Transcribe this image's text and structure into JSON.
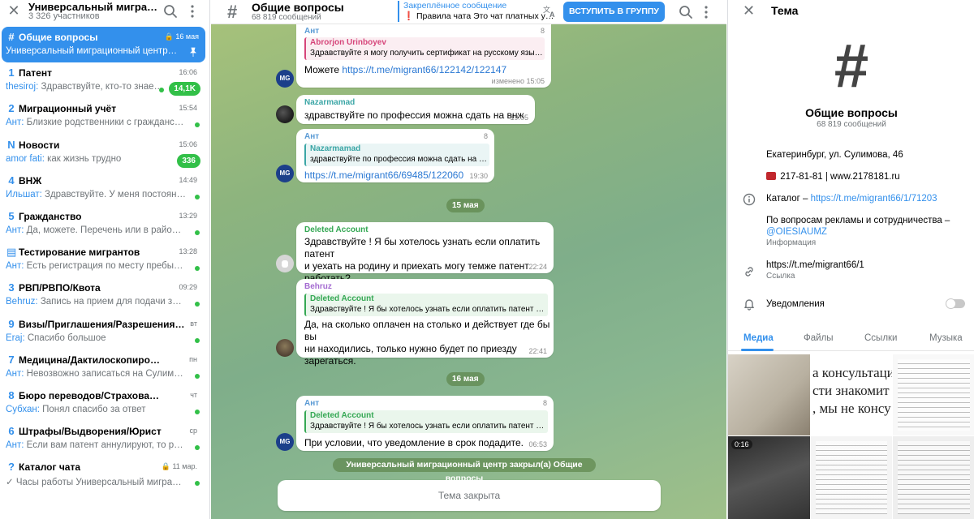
{
  "sidebar": {
    "title": "Универсальный миграционный центр",
    "subtitle": "3 326 участников",
    "topics": [
      {
        "icon": "#",
        "name": "Общие вопросы",
        "time": "16 мая",
        "last": "Универсальный миграционный центр зак…",
        "who": "",
        "active": true
      },
      {
        "icon": "1",
        "name": "Патент",
        "time": "16:06",
        "who": "thesiroj:",
        "last": " Здравствуйте, кто-то знае…",
        "badge": "14,1K"
      },
      {
        "icon": "2",
        "name": "Миграционный учёт",
        "time": "15:54",
        "who": "Ант:",
        "last": " Близкие родственники с гражданство…"
      },
      {
        "icon": "N",
        "name": "Новости",
        "time": "15:06",
        "who": "amor fati:",
        "last": " как жизнь трудно",
        "badge": "336"
      },
      {
        "icon": "4",
        "name": "ВНЖ",
        "time": "14:49",
        "who": "Ильшат:",
        "last": " Здравствуйте. У меня постоянный…"
      },
      {
        "icon": "5",
        "name": "Гражданство",
        "time": "13:29",
        "who": "Ант:",
        "last": " Да, можете. Перечень или в районном…"
      },
      {
        "icon": "▤",
        "name": "Тестирование мигрантов",
        "time": "13:28",
        "who": "Ант:",
        "last": " Есть регистрация по месту пребывани…"
      },
      {
        "icon": "3",
        "name": "РВП/РВПО/Квота",
        "time": "09:29",
        "who": "Behruz:",
        "last": " Запись на прием для подачи заявк…"
      },
      {
        "icon": "9",
        "name": "Визы/Приглашения/Разрешения на ра…",
        "time": "вт",
        "who": "Eraj:",
        "last": " Спасибо большое"
      },
      {
        "icon": "7",
        "name": "Медицина/Дактилоскопирование",
        "time": "пн",
        "who": "Ант:",
        "last": " Невозвожно записаться на Сулимова …"
      },
      {
        "icon": "8",
        "name": "Бюро переводов/Страхование",
        "time": "чт",
        "who": "Субхан:",
        "last": " Понял спасибо за ответ"
      },
      {
        "icon": "6",
        "name": "Штрафы/Выдворения/Юрист",
        "time": "ср",
        "who": "Ант:",
        "last": " Если вам патент аннулируют, то работ…"
      },
      {
        "icon": "?",
        "name": "Каталог чата",
        "time": "11 мар.",
        "who": "✓",
        "last": " Часы работы Универсальный миграцио…"
      }
    ]
  },
  "chat": {
    "title": "Общие вопросы",
    "subtitle": "68 819 сообщений",
    "pinned_label": "Закреплённое сообщение",
    "pinned_text": "❗ Правила чата Это чат платных у…",
    "join_label": "ВСТУПИТЬ В ГРУППУ",
    "messages": {
      "m1": {
        "sender": "Ант",
        "num": "8",
        "reply_name": "Abrorjon Urinboyev",
        "reply_text": "Здравствуйте я могу получить сертификат на русскому языку в…",
        "text": "Можете ",
        "link": "https://t.me/migrant66/122142/122147",
        "time": "изменено 15:05"
      },
      "m2": {
        "sender": "Nazarmamad",
        "text": "здравствуйте по профессия можна сдать на внж",
        "time": "19:05"
      },
      "m3": {
        "sender": "Ант",
        "num": "8",
        "reply_name": "Nazarmamad",
        "reply_text": "здравствуйте по профессия можна сдать на внж",
        "link": "https://t.me/migrant66/69485/122060",
        "time": "19:30"
      },
      "date1": "15 мая",
      "m4": {
        "sender": "Deleted Account",
        "line1": "Здравствуйте  ! Я бы хотелось узнать если оплатить патент",
        "line2": "и  уехать на родину и приехать могу темже патент",
        "line3": "работать?",
        "time": "22:24"
      },
      "m5": {
        "sender": "Behruz",
        "reply_name": "Deleted Account",
        "reply_text": "Здравствуйте ! Я бы хотелось узнать если оплатить патент и уе…",
        "line1": "Да, на сколько оплачен на столько и действует где бы вы",
        "line2": "ни находились, только нужно будет по приезду зарегаться.",
        "time": "22:41"
      },
      "date2": "16 мая",
      "m6": {
        "sender": "Ант",
        "num": "8",
        "reply_name": "Deleted Account",
        "reply_text": "Здравствуйте ! Я бы хотелось узнать если оплатить патент и уе…",
        "text": "При условии, что уведомление в срок подадите.",
        "time": "06:53"
      }
    },
    "avatar_mg": "MG",
    "service_msg": "Универсальный миграционный центр закрыл(а) Общие вопросы",
    "closed_label": "Тема закрыта"
  },
  "panel": {
    "title": "Тема",
    "hash": "#",
    "name": "Общие вопросы",
    "count": "68 819 сообщений",
    "address": "Екатеринбург, ул. Сулимова, 46",
    "phone": "217-81-81 | www.2178181.ru",
    "catalog_prefix": "Каталог – ",
    "catalog_link": "https://t.me/migrant66/1/71203",
    "ads_text": "По вопросам рекламы и сотрудничества –",
    "ads_link": "@OIESIAUMZ",
    "info_label": "Информация",
    "link": "https://t.me/migrant66/1",
    "link_label": "Ссылка",
    "notifications": "Уведомления",
    "tabs": [
      "Медиа",
      "Файлы",
      "Ссылки",
      "Музыка"
    ],
    "video_duration": "0:16",
    "media_text_1": "а консультаци",
    "media_text_2": "сти знакомит",
    "media_text_3": ", мы не консу"
  },
  "colors": {
    "accent": "#3390ec",
    "unread": "#32c048"
  }
}
